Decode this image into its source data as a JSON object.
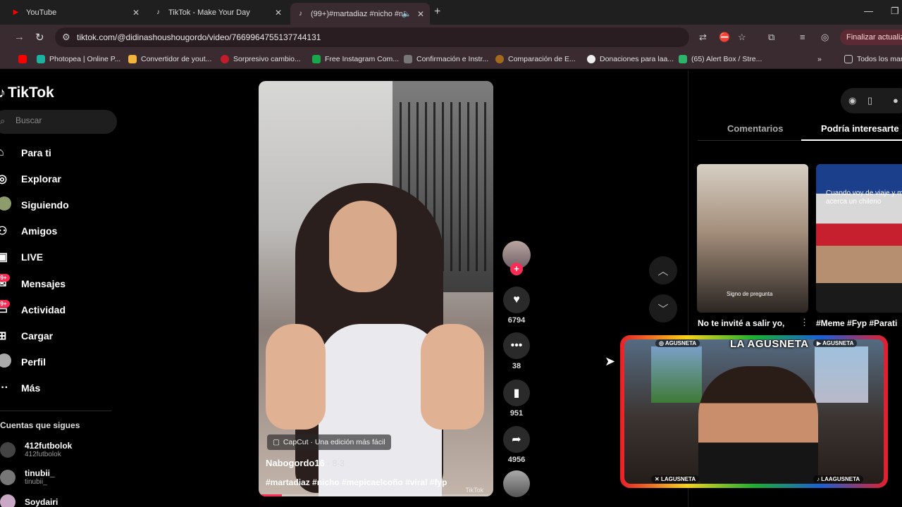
{
  "browser": {
    "tabs": [
      {
        "title": "YouTube",
        "icon": "youtube-icon",
        "color": "#ff0000"
      },
      {
        "title": "TikTok - Make Your Day",
        "icon": "tiktok-icon"
      },
      {
        "title": "(99+)#martadiaz #nicho #m",
        "icon": "tiktok-icon",
        "active": true
      }
    ],
    "url": "tiktok.com/@didinashoushougordo/video/7669964755137744131",
    "update_label": "Finalizar actualiza",
    "bookmarks": [
      "Photopea | Online P...",
      "Convertidor de yout...",
      "Sorpresivo cambio...",
      "Free Instagram Com...",
      "Confirmación e Instr...",
      "Comparación de E...",
      "Donaciones para laa...",
      "(65) Alert Box / Stre...",
      "Todos los mar"
    ]
  },
  "sidebar": {
    "logo": "TikTok",
    "search_placeholder": "Buscar",
    "items": [
      {
        "label": "Para ti",
        "icon": "home-icon"
      },
      {
        "label": "Explorar",
        "icon": "compass-icon"
      },
      {
        "label": "Siguiendo",
        "icon": "following-icon"
      },
      {
        "label": "Amigos",
        "icon": "friends-icon"
      },
      {
        "label": "LIVE",
        "icon": "live-icon"
      },
      {
        "label": "Mensajes",
        "icon": "messages-icon",
        "badge": "99+"
      },
      {
        "label": "Actividad",
        "icon": "activity-icon",
        "badge": "99+"
      },
      {
        "label": "Cargar",
        "icon": "upload-icon"
      },
      {
        "label": "Perfil",
        "icon": "profile-icon"
      },
      {
        "label": "Más",
        "icon": "more-icon"
      }
    ],
    "following_title": "Cuentas que sigues",
    "following": [
      {
        "name": "412futbolok",
        "handle": "412futbolok"
      },
      {
        "name": "tinubii_",
        "handle": "tinubii_"
      },
      {
        "name": "Soydairi",
        "handle": ""
      }
    ]
  },
  "video": {
    "capcut_label": "CapCut · Una edición más fácil",
    "author": "Nabogordo16",
    "date": " · 8-3",
    "tags": "#martadiaz #nicho #mepicaelcoño #viral  #fyp",
    "watermark": "TikTok",
    "progress": 0.1
  },
  "actions": {
    "likes": "6794",
    "comments": "38",
    "saves": "951",
    "shares": "4956"
  },
  "right_panel": {
    "tab_comments": "Comentarios",
    "tab_suggested": "Podría interesarte",
    "items": [
      {
        "title": "No te invité a salir yo,",
        "caption": "Signo de pregunta"
      },
      {
        "title": "#Meme #Fyp #Parati",
        "caption": "Cuando voy de viaje y me acerca un chileno"
      }
    ]
  },
  "stream_overlay": {
    "logo": "LA AGUSNETA",
    "tag_instagram": "AGUSNETA",
    "tag_youtube": "AGUSNETA",
    "tag_x": "LAGUSNETA",
    "tag_tiktok": "LAAGUSNETA"
  }
}
